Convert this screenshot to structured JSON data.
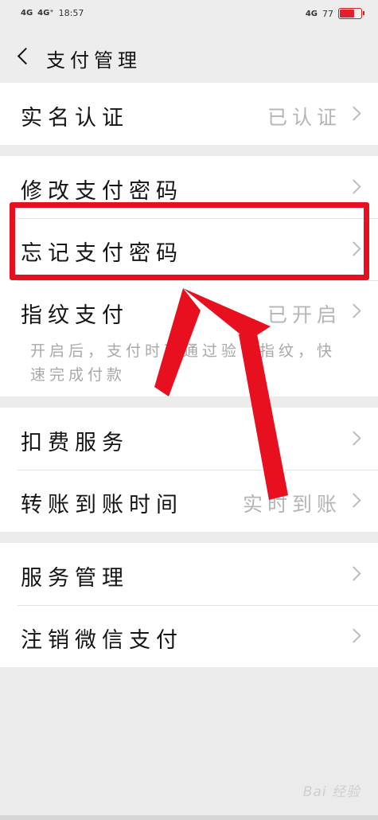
{
  "status_bar": {
    "signal_1": "4G",
    "signal_2": "4G⁺",
    "time": "18:57",
    "network_right": "4G",
    "battery_percent": "77",
    "battery_level": 0.77,
    "battery_color": "#e02030"
  },
  "nav": {
    "back_icon": "chevron-left-icon",
    "title": "支付管理"
  },
  "groups": [
    {
      "items": [
        {
          "label": "实名认证",
          "value": "已认证"
        }
      ]
    },
    {
      "items": [
        {
          "label": "修改支付密码",
          "value": ""
        },
        {
          "label": "忘记支付密码",
          "value": ""
        },
        {
          "label": "指纹支付",
          "value": "已开启",
          "description": "开启后，支付时可通过验证指纹，快速完成付款"
        }
      ]
    },
    {
      "items": [
        {
          "label": "扣费服务",
          "value": ""
        },
        {
          "label": "转账到账时间",
          "value": "实时到账"
        }
      ]
    },
    {
      "items": [
        {
          "label": "服务管理",
          "value": ""
        },
        {
          "label": "注销微信支付",
          "value": ""
        }
      ]
    }
  ],
  "annotation": {
    "color": "#e8101f",
    "highlight_target": "忘记支付密码"
  },
  "watermark": "Bai 经验"
}
